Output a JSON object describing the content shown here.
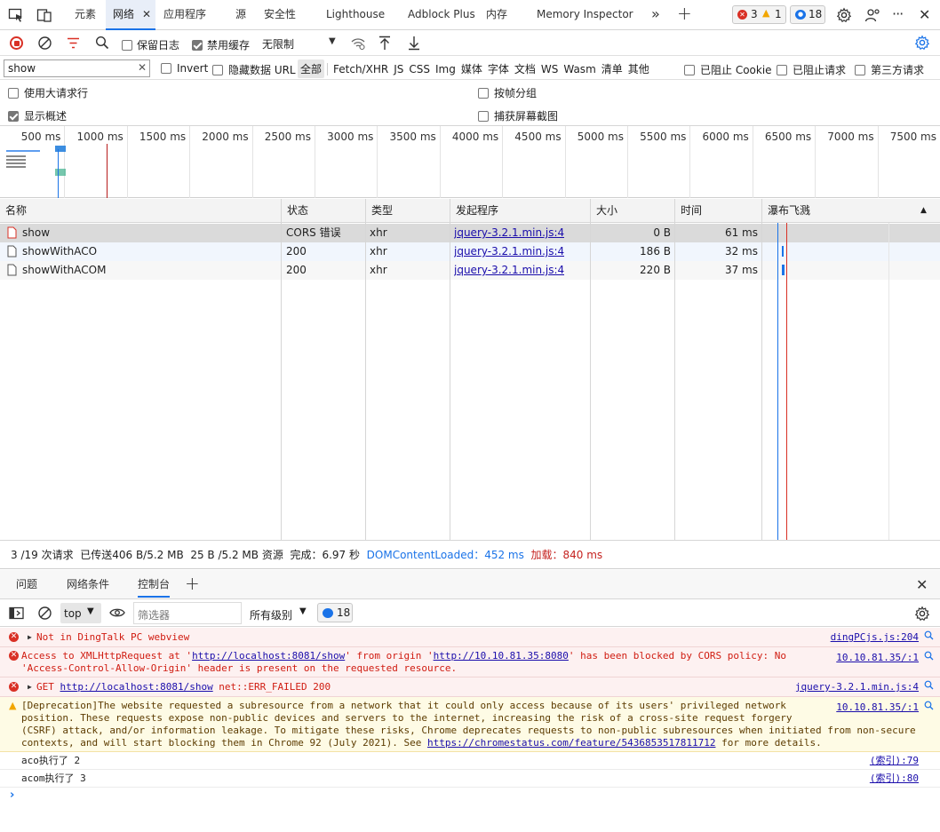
{
  "tabs": {
    "elements": "元素",
    "network": "网络",
    "application": "应用程序",
    "sources": "源",
    "security": "安全性",
    "lighthouse": "Lighthouse",
    "adblock": "Adblock Plus",
    "memory": "内存",
    "memory_inspector": "Memory Inspector",
    "errors": "3",
    "warnings": "1",
    "messages": "18"
  },
  "toolbar": {
    "preserve_log": "保留日志",
    "disable_cache": "禁用缓存",
    "throttle": "无限制"
  },
  "filter": {
    "value": "show",
    "invert": "Invert",
    "hide_data_url": "隐藏数据 URL",
    "types": [
      "全部",
      "Fetch/XHR",
      "JS",
      "CSS",
      "Img",
      "媒体",
      "字体",
      "文档",
      "WS",
      "Wasm",
      "清单",
      "其他"
    ],
    "blocked_cookies": "已阻止 Cookie",
    "blocked_requests": "已阻止请求",
    "third_party": "第三方请求"
  },
  "options": {
    "big_rows": "使用大请求行",
    "group_by_frame": "按帧分组",
    "show_overview": "显示概述",
    "capture_screenshots": "捕获屏幕截图"
  },
  "overview": {
    "ticks": [
      "500 ms",
      "1000 ms",
      "1500 ms",
      "2000 ms",
      "2500 ms",
      "3000 ms",
      "3500 ms",
      "4000 ms",
      "4500 ms",
      "5000 ms",
      "5500 ms",
      "6000 ms",
      "6500 ms",
      "7000 ms",
      "7500 ms"
    ]
  },
  "table": {
    "headers": {
      "name": "名称",
      "status": "状态",
      "type": "类型",
      "initiator": "发起程序",
      "size": "大小",
      "time": "时间",
      "waterfall": "瀑布飞溅"
    },
    "rows": [
      {
        "name": "show",
        "status": "CORS 错误",
        "type": "xhr",
        "initiator": "jquery-3.2.1.min.js:4",
        "size": "0 B",
        "time": "61 ms"
      },
      {
        "name": "showWithACO",
        "status": "200",
        "type": "xhr",
        "initiator": "jquery-3.2.1.min.js:4",
        "size": "186 B",
        "time": "32 ms"
      },
      {
        "name": "showWithACOM",
        "status": "200",
        "type": "xhr",
        "initiator": "jquery-3.2.1.min.js:4",
        "size": "220 B",
        "time": "37 ms"
      }
    ]
  },
  "summary": {
    "requests": "3 /19 次请求",
    "transferred": "已传送406 B/5.2 MB",
    "resources": "25 B /5.2 MB 资源",
    "finish": "完成：6.97 秒",
    "dom_content_loaded": "DOMContentLoaded：452 ms",
    "load": "加载：840 ms"
  },
  "drawer": {
    "issues": "问题",
    "network_conditions": "网络条件",
    "console": "控制台"
  },
  "console_toolbar": {
    "context": "top",
    "filter_placeholder": "筛选器",
    "levels": "所有级别",
    "messages": "18"
  },
  "console": [
    {
      "level": "error",
      "lines": [
        "Not in DingTalk PC webview"
      ],
      "source": "dingPCjs.js:204"
    },
    {
      "level": "error",
      "lines": [
        "Access to XMLHttpRequest at 'http://localhost:8081/show' from origin 'http://10.10.81.35:8080' has been blocked by CORS policy: No",
        "'Access-Control-Allow-Origin' header is present on the requested resource."
      ],
      "source": "10.10.81.35/:1"
    },
    {
      "level": "error",
      "lines": [
        "GET http://localhost:8081/show net::ERR_FAILED 200"
      ],
      "source": "jquery-3.2.1.min.js:4"
    },
    {
      "level": "warning",
      "lines": [
        "[Deprecation]The website requested a subresource from a network that it could only access because of its users' privileged network",
        "position. These requests expose non-public devices and servers to the internet, increasing the risk of a cross-site request forgery",
        "(CSRF) attack, and/or information leakage. To mitigate these risks, Chrome deprecates requests to non-public subresources when initiated from non-secure",
        "contexts, and will start blocking them in Chrome 92 (July 2021). See https://chromestatus.com/feature/5436853517811712 for more details."
      ],
      "source": "10.10.81.35/:1"
    },
    {
      "level": "info",
      "lines": [
        "aco执行了 2"
      ],
      "source": "(索引):79"
    },
    {
      "level": "info",
      "lines": [
        "acom执行了 3"
      ],
      "source": "(索引):80"
    }
  ]
}
